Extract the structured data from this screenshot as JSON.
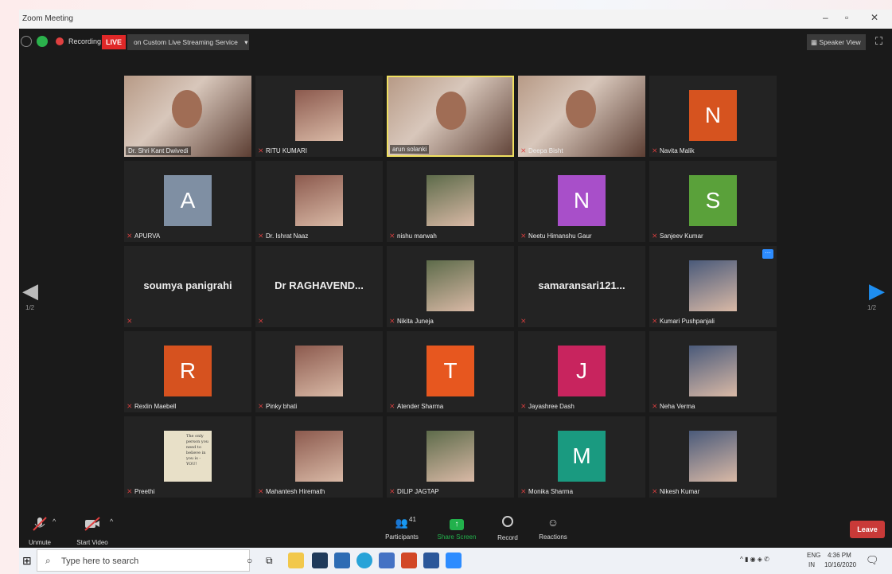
{
  "window": {
    "title": "Zoom Meeting"
  },
  "topbar": {
    "recording_label": "Recording",
    "live_label": "LIVE",
    "stream_label": "on Custom Live Streaming Service",
    "speaker_view_label": "Speaker View"
  },
  "tiles": [
    {
      "name": "Dr. Shri Kant Dwivedi",
      "kind": "video"
    },
    {
      "name": "RITU KUMARI",
      "kind": "photo"
    },
    {
      "name": "arun solanki",
      "kind": "video"
    },
    {
      "name": "Deepa Bisht",
      "kind": "video"
    },
    {
      "name": "Navita Malik",
      "kind": "letter",
      "letter": "N",
      "color": "#d6531f"
    },
    {
      "name": "APURVA",
      "kind": "letter",
      "letter": "A",
      "color": "#7f8fa3"
    },
    {
      "name": "Dr. Ishrat Naaz",
      "kind": "photo"
    },
    {
      "name": "nishu marwah",
      "kind": "photo"
    },
    {
      "name": "Neetu Himanshu Gaur",
      "kind": "letter",
      "letter": "N",
      "color": "#a84fc9"
    },
    {
      "name": "Sanjeev Kumar",
      "kind": "letter",
      "letter": "S",
      "color": "#5aa13a"
    },
    {
      "name": "",
      "kind": "text",
      "display": "soumya panigrahi"
    },
    {
      "name": "",
      "kind": "text",
      "display": "Dr  RAGHAVEND..."
    },
    {
      "name": "Nikita Juneja",
      "kind": "photo"
    },
    {
      "name": "",
      "kind": "text",
      "display": "samaransari121..."
    },
    {
      "name": "Kumari Pushpanjali",
      "kind": "photo"
    },
    {
      "name": "Rexlin Maebell",
      "kind": "letter",
      "letter": "R",
      "color": "#d6521f"
    },
    {
      "name": "Pinky bhati",
      "kind": "photo"
    },
    {
      "name": "Atender Sharma",
      "kind": "letter",
      "letter": "T",
      "color": "#e7571f"
    },
    {
      "name": "Jayashree Dash",
      "kind": "letter",
      "letter": "J",
      "color": "#c8245e"
    },
    {
      "name": "Neha Verma",
      "kind": "photo"
    },
    {
      "name": "Preethi",
      "kind": "photo",
      "quote": "The only person you need to believe in you is - YOU!"
    },
    {
      "name": "Mahantesh Hiremath",
      "kind": "photo"
    },
    {
      "name": "DILIP JAGTAP",
      "kind": "photo"
    },
    {
      "name": "Monika Sharma",
      "kind": "letter",
      "letter": "M",
      "color": "#1a9a80"
    },
    {
      "name": "Nikesh Kumar",
      "kind": "photo"
    }
  ],
  "pagination": {
    "left": "1/2",
    "right": "1/2"
  },
  "controls": {
    "unmute": "Unmute",
    "start_video": "Start Video",
    "participants": "Participants",
    "participants_count": "41",
    "share_screen": "Share Screen",
    "record": "Record",
    "reactions": "Reactions",
    "leave": "Leave"
  },
  "taskbar": {
    "search_placeholder": "Type here to search",
    "lang": "ENG",
    "lang2": "IN",
    "time": "4:36 PM",
    "date": "10/16/2020"
  },
  "colors": {
    "accent_red": "#e02828",
    "share_green": "#22b14c",
    "active_border": "#f0e060"
  }
}
